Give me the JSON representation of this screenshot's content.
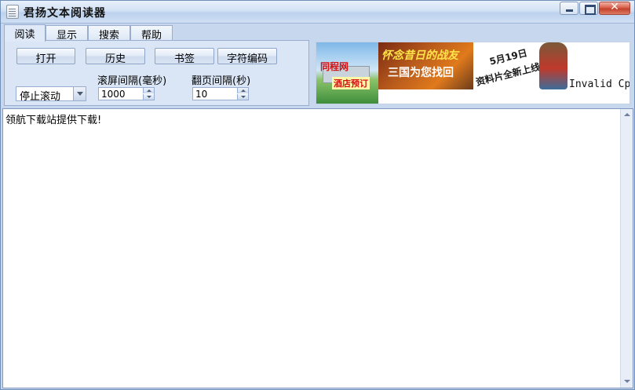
{
  "window": {
    "title": "君扬文本阅读器",
    "app_icon": "document-icon",
    "controls": {
      "close_glyph": "✕"
    }
  },
  "tabs": [
    {
      "label": "阅读",
      "active": true
    },
    {
      "label": "显示",
      "active": false
    },
    {
      "label": "搜索",
      "active": false
    },
    {
      "label": "帮助",
      "active": false
    }
  ],
  "toolbar": {
    "open_label": "打开",
    "history_label": "历史",
    "bookmark_label": "书签",
    "encoding_label": "字符编码"
  },
  "scroll": {
    "mode_value": "停止滚动",
    "scroll_interval_label": "滚屏间隔(毫秒)",
    "scroll_interval_value": "1000",
    "page_interval_label": "翻页间隔(秒)",
    "page_interval_value": "10"
  },
  "ads": {
    "ad1_title": "同程网",
    "ad1_sub": "酒店预订",
    "ad2_title": "怀念昔日的战友",
    "ad2_sub": "三国为您找回",
    "ad3_date": "5月19日",
    "ad3_sub": "资料片全新上线",
    "invalid_text": "Invalid Cp"
  },
  "document": {
    "content": "领航下载站提供下载!"
  },
  "colors": {
    "accent": "#98add0",
    "close_red": "#c2412c",
    "ad_red": "#d21414"
  }
}
